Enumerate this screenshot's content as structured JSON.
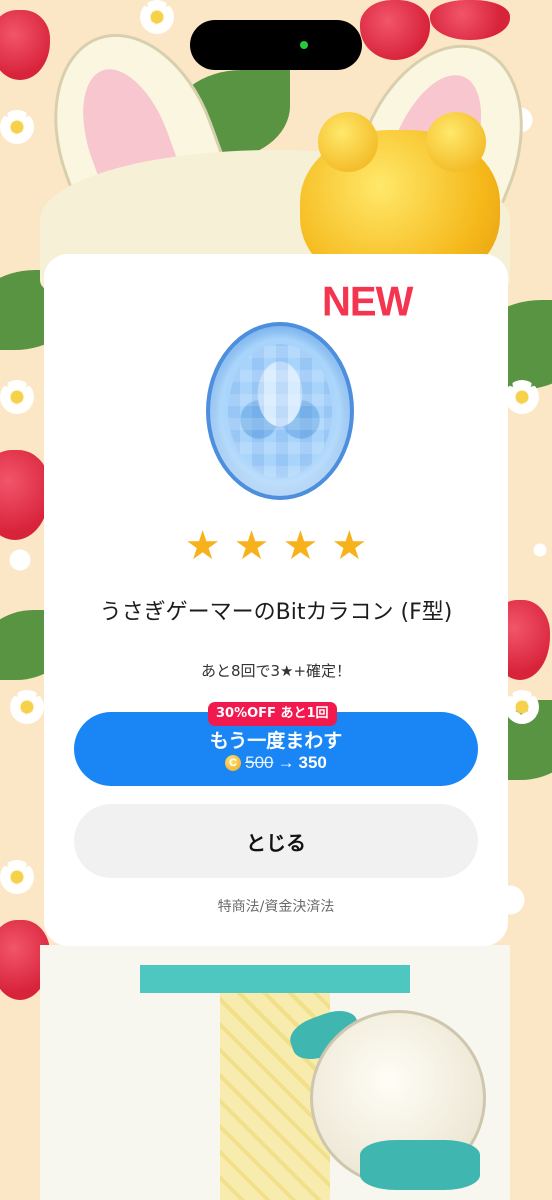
{
  "modal": {
    "new_badge": "NEW",
    "star_glyph": "★",
    "rarity_stars": 4,
    "item_name": "うさぎゲーマーのBitカラコン (F型)",
    "guarantee_text": "あと8回で3★+確定！",
    "spin": {
      "discount_label": "30%OFF あと1回",
      "label": "もう一度まわす",
      "coin_symbol": "C",
      "old_price": "500",
      "arrow": "→",
      "new_price": "350"
    },
    "close_label": "とじる",
    "legal_link": "特商法/資金決済法"
  },
  "colors": {
    "accent_blue": "#1a86f6",
    "discount_red": "#f2194f",
    "new_red": "#f5354f",
    "star_gold": "#f7b21b"
  },
  "icons": [
    "coin-icon",
    "star-icon",
    "item-icon"
  ]
}
